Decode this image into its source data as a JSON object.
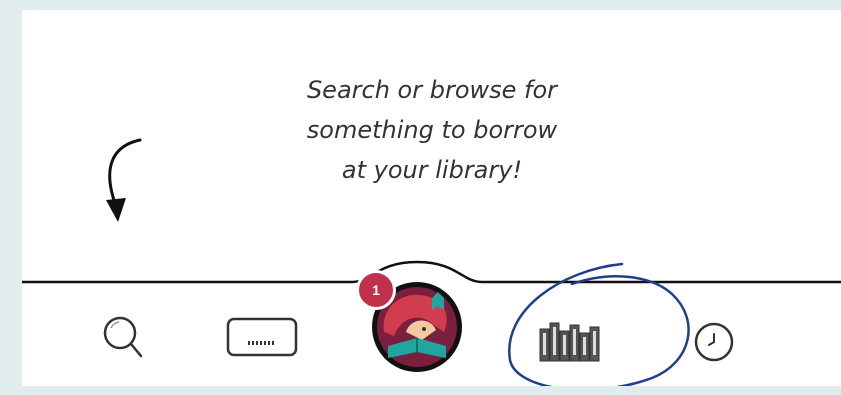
{
  "hint": {
    "line1": "Search or browse for",
    "line2": "something to borrow",
    "line3": "at your library!"
  },
  "nav": {
    "items": [
      {
        "icon": "search-icon"
      },
      {
        "icon": "keyboard-icon"
      },
      {
        "icon": "libby-logo-icon"
      },
      {
        "icon": "shelf-icon"
      },
      {
        "icon": "clock-icon"
      }
    ],
    "badge_count": "1"
  },
  "colors": {
    "background": "#e1ecec",
    "panel": "#ffffff",
    "badge": "#c2314b",
    "logo_ring": "#111111",
    "logo_face": "#7a1f3d",
    "annotation": "#1f3e8c"
  }
}
